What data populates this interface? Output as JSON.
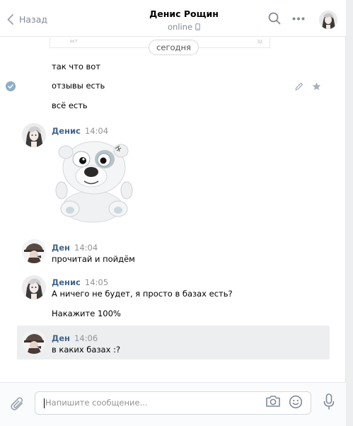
{
  "header": {
    "back_label": "Назад",
    "peer_name": "Денис Рощин",
    "peer_status": "online"
  },
  "history": {
    "prev_card_meta": "32",
    "prev_card_meta2": "ост",
    "date_separator": "сегодня",
    "own_messages": [
      "так что вот",
      "отзывы есть",
      "всё есть"
    ],
    "blocks": [
      {
        "author": "Денис",
        "time": "14:04",
        "sticker": "white-bear-sticker"
      },
      {
        "author": "Ден",
        "time": "14:04",
        "text": "прочитай и пойдём"
      },
      {
        "author": "Денис",
        "time": "14:05",
        "text": "А ничего не будет, я просто в базах есть?",
        "text2": "Накажите 100%"
      },
      {
        "author": "Ден",
        "time": "14:06",
        "text": "в каких базах :?"
      }
    ]
  },
  "composer": {
    "placeholder": "Напишите сообщение..."
  },
  "colors": {
    "author_link": "#42648b",
    "muted": "#828a99",
    "highlight_row": "#edeef0"
  }
}
